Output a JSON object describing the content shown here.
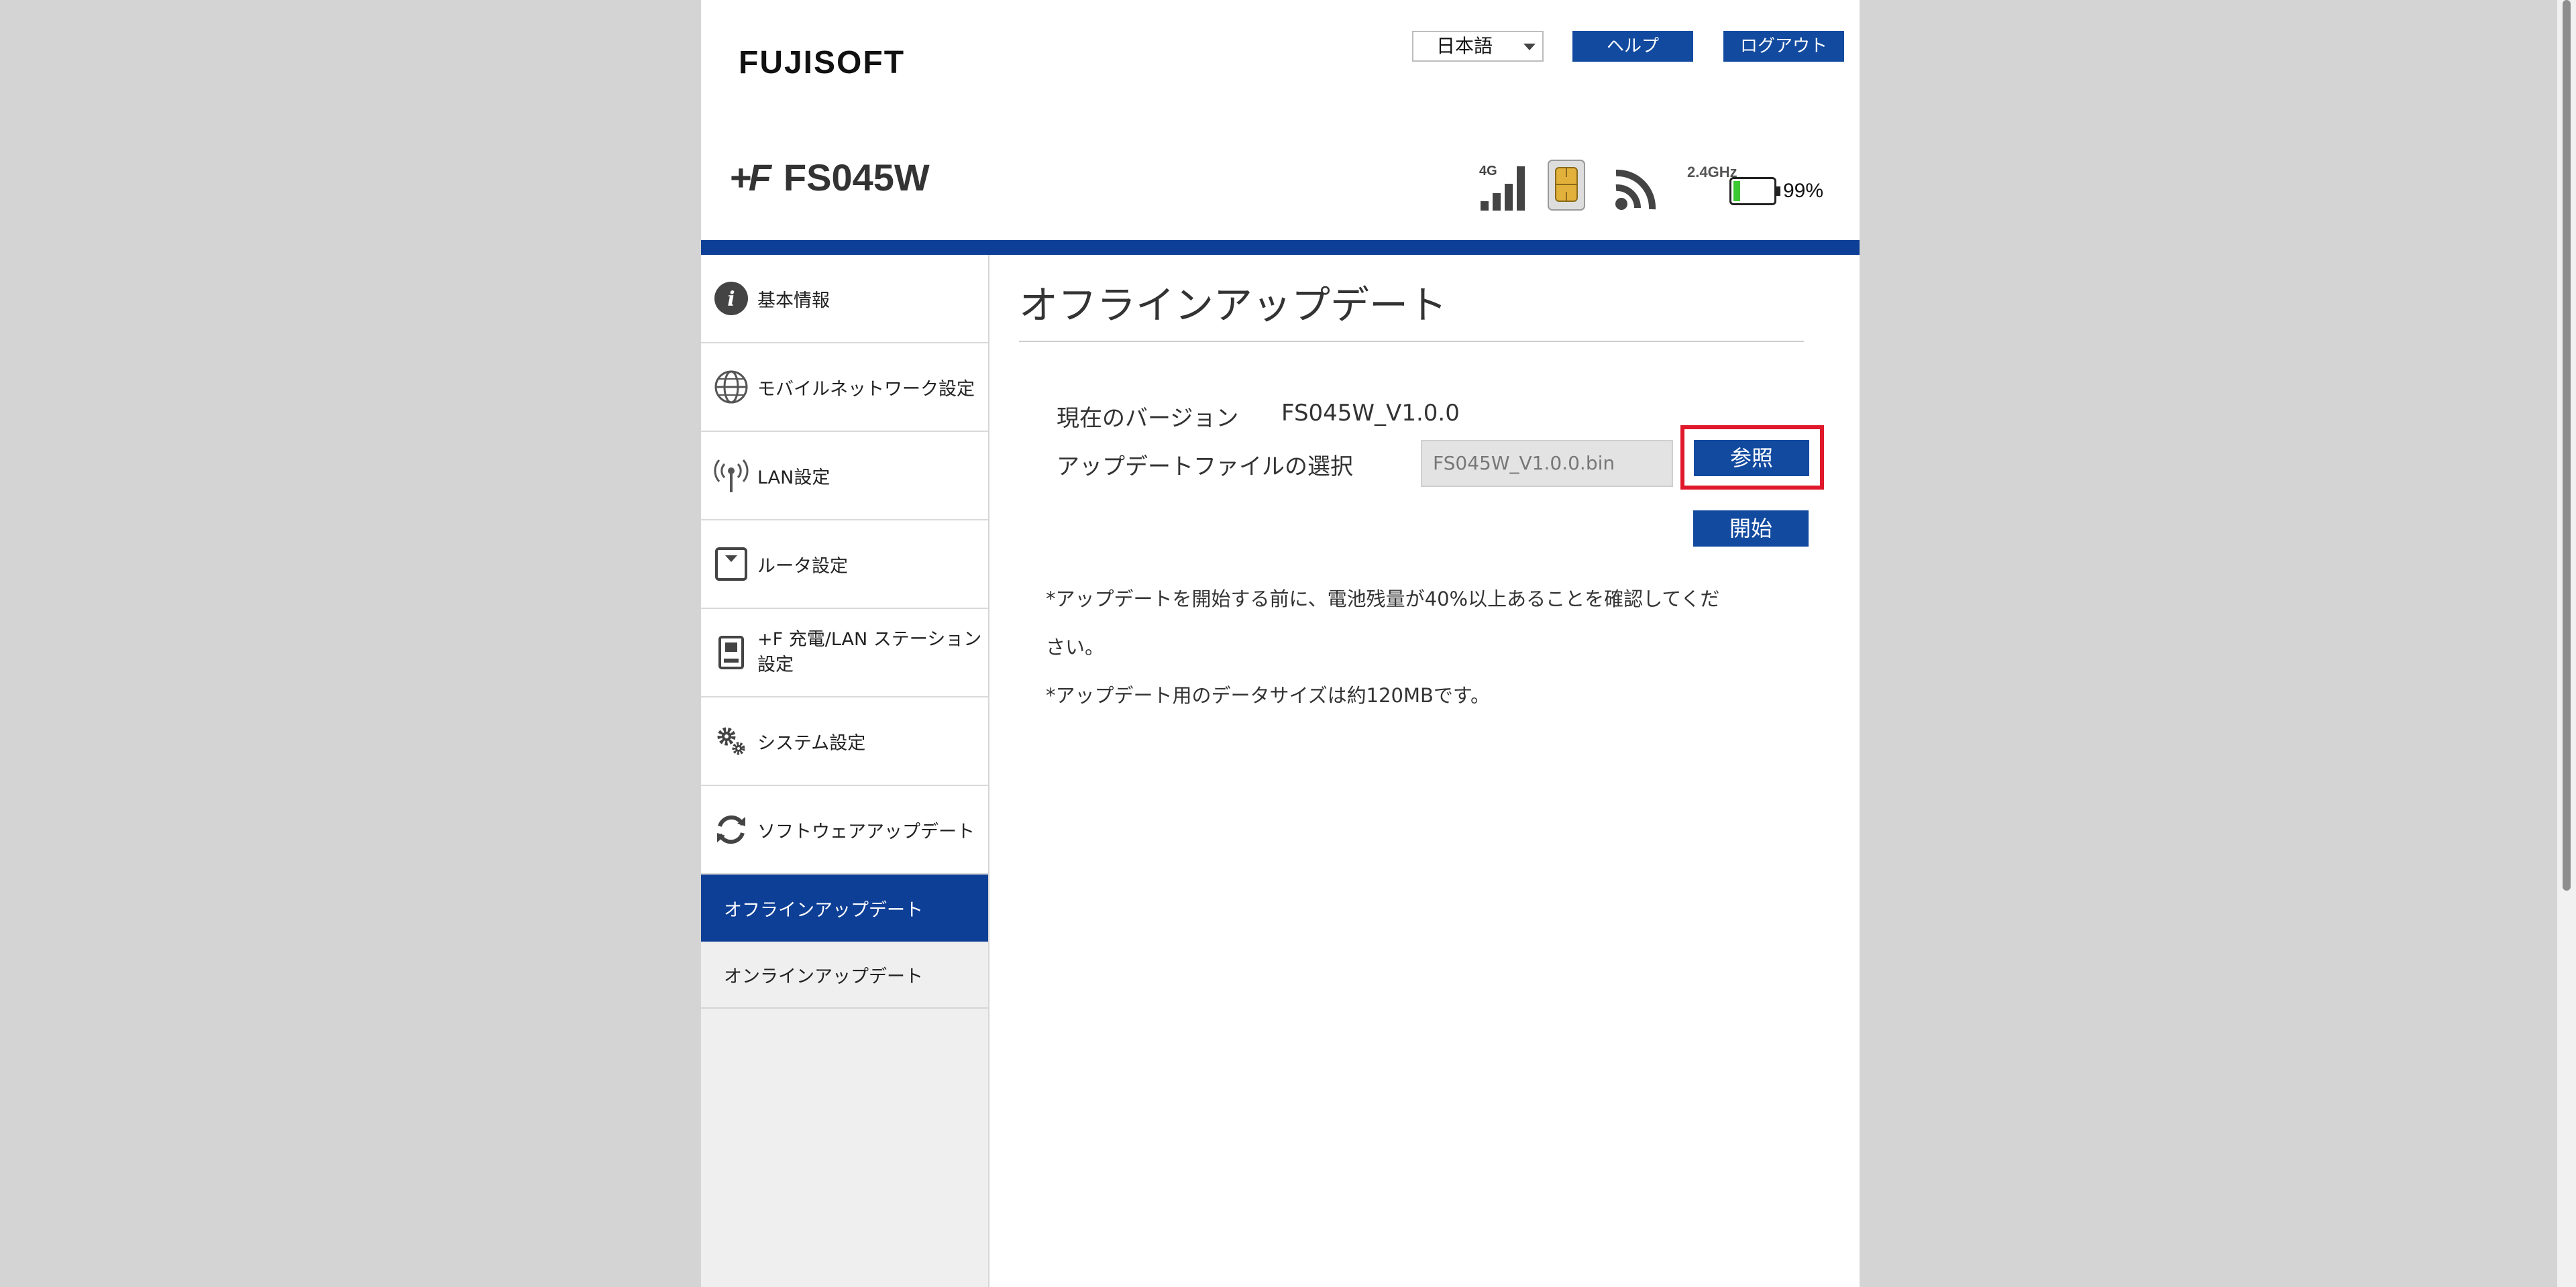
{
  "header": {
    "brand": "FUJISOFT",
    "language": "日本語",
    "help_label": "ヘルプ",
    "logout_label": "ログアウト",
    "model_mark": "+F",
    "model_name": "FS045W",
    "network_type": "4G",
    "wifi_band": "2.4GHz",
    "battery_percent": "99%",
    "battery_level": 0.99
  },
  "sidebar": {
    "items": [
      {
        "label": "基本情報",
        "icon": "info-icon"
      },
      {
        "label": "モバイルネットワーク設定",
        "icon": "globe-icon"
      },
      {
        "label": "LAN設定",
        "icon": "antenna-icon"
      },
      {
        "label": "ルータ設定",
        "icon": "router-icon"
      },
      {
        "label_line1": "+F 充電/LAN ステーション",
        "label_line2": "設定",
        "icon": "station-icon"
      },
      {
        "label": "システム設定",
        "icon": "gears-icon"
      },
      {
        "label": "ソフトウェアアップデート",
        "icon": "refresh-icon"
      }
    ],
    "sub_items": [
      {
        "label": "オフラインアップデート",
        "active": true
      },
      {
        "label": "オンラインアップデート",
        "active": false
      }
    ]
  },
  "main": {
    "title": "オフラインアップデート",
    "current_version_label": "現在のバージョン",
    "current_version_value": "FS045W_V1.0.0",
    "file_select_label": "アップデートファイルの選択",
    "file_value": "FS045W_V1.0.0.bin",
    "browse_label": "参照",
    "start_label": "開始",
    "note1_line1": "*アップデートを開始する前に、電池残量が40%以上あることを確認してくだ",
    "note1_line2": "さい。",
    "note2": "*アップデート用のデータサイズは約120MBです。"
  },
  "colors": {
    "accent": "#124aa0",
    "bar": "#0e3f96",
    "highlight": "#e0182b",
    "battery": "#3cc832"
  }
}
